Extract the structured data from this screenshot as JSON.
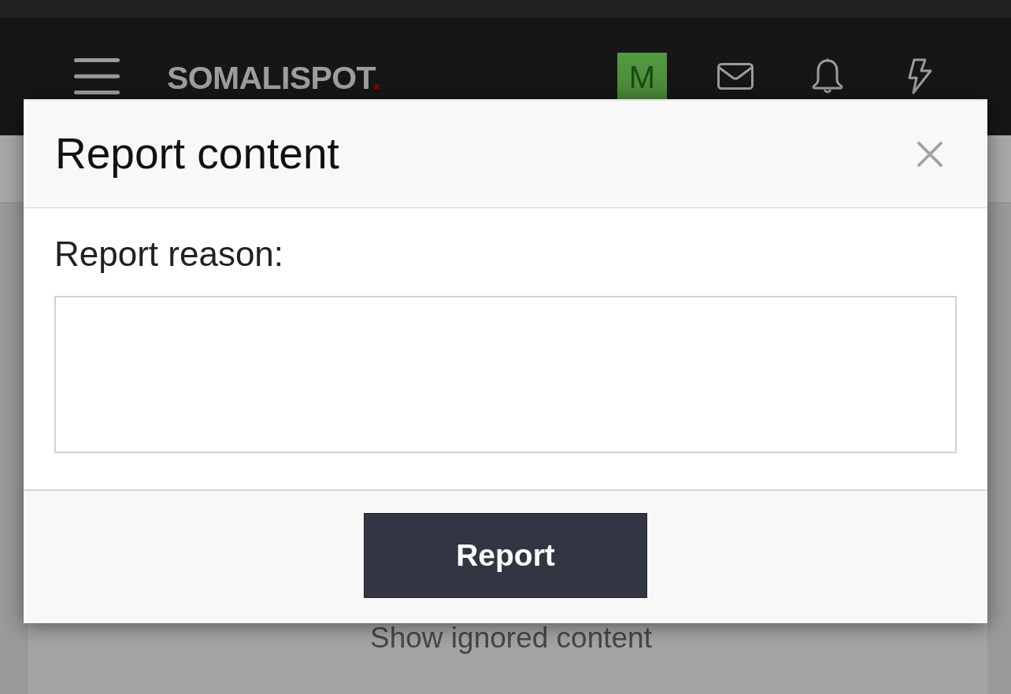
{
  "header": {
    "logo": {
      "text": "SOMALISPOT",
      "mark": "."
    },
    "avatar": "M"
  },
  "page": {
    "ignored_link": "Show ignored content"
  },
  "modal": {
    "title": "Report content",
    "field_label": "Report reason:",
    "submit_button": "Report"
  }
}
